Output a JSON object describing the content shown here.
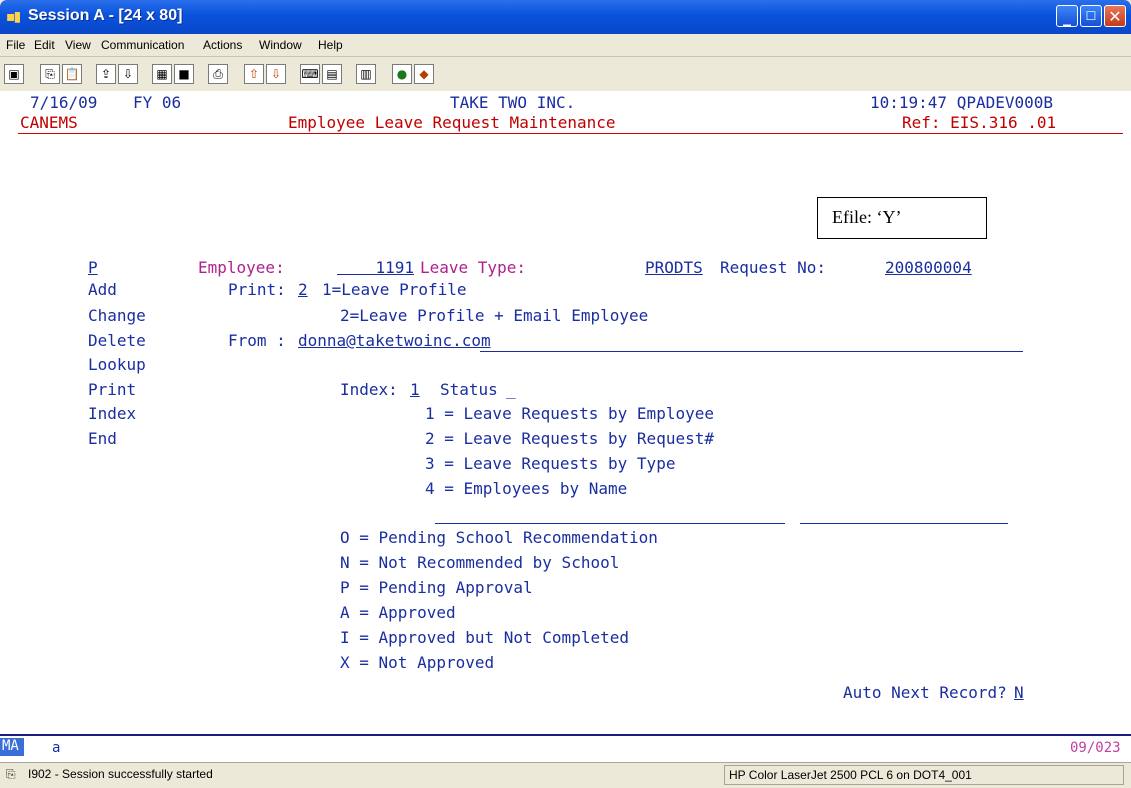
{
  "window": {
    "title": "Session A - [24 x 80]"
  },
  "menu": [
    "File",
    "Edit",
    "View",
    "Communication",
    "Actions",
    "Window",
    "Help"
  ],
  "toolbar_icons": [
    "display-icon",
    "copy-icon",
    "paste-icon",
    "send-icon",
    "receive-icon",
    "macro-icon",
    "record-icon",
    "print-icon",
    "transfer-up-icon",
    "transfer-down-icon",
    "keyboard-icon",
    "keypad-icon",
    "clipboard-icon",
    "globe-icon",
    "help-icon"
  ],
  "header": {
    "date": "7/16/09",
    "fy": "FY 06",
    "company": "TAKE TWO INC.",
    "time_session": "10:19:47 QPADEV000B",
    "program": "CANEMS",
    "screen_title": "Employee Leave Request Maintenance",
    "ref": "Ref: EIS.316 .01"
  },
  "actions": {
    "cmd": "P",
    "items": [
      "Add",
      "Change",
      "Delete",
      "Lookup",
      "Print",
      "Index",
      "End"
    ]
  },
  "fields": {
    "employee_label": "Employee:",
    "employee_value": "    1191",
    "leave_type_label": "Leave Type:",
    "leave_type_value": "PRODTS",
    "request_label": "Request No:",
    "request_value": "200800004",
    "print_label": "Print:",
    "print_value": "2",
    "print_opt1": "1=Leave Profile",
    "print_opt2": "2=Leave Profile + Email Employee",
    "from_label": "From :",
    "from_value": "donna@taketwoinc.com",
    "index_label": "Index:",
    "index_value": "1",
    "status_label": "Status",
    "status_value": "_"
  },
  "efile_note": "Efile:  ‘Y’",
  "index_options": [
    "1 = Leave Requests by Employee",
    "2 = Leave Requests by Request#",
    "3 = Leave Requests by Type",
    "4 = Employees by Name"
  ],
  "status_options": [
    "O = Pending School Recommendation",
    "N = Not Recommended by School",
    "P = Pending Approval",
    "A = Approved",
    "I = Approved but Not Completed",
    "X = Not Approved"
  ],
  "auto_next": {
    "label": "Auto Next Record?",
    "value": "N"
  },
  "oia": {
    "mode": "MA",
    "indicator": "a",
    "cursor": "09/023"
  },
  "status": {
    "message": "I902 - Session successfully started",
    "printer": "HP Color LaserJet 2500 PCL 6 on DOT4_001"
  },
  "colors": {
    "title_blue": "#0a52dd",
    "field_blue": "#1a2ea0",
    "header_red": "#c00000",
    "label_magenta": "#b0208e"
  }
}
